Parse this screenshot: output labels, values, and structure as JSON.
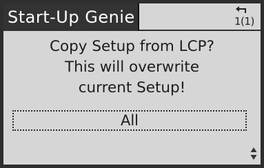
{
  "header": {
    "title": "Start-Up Genie",
    "back_level": "1(1)",
    "back_icon": "back-arrow-icon"
  },
  "message": {
    "lines": [
      "Copy Setup from LCP?",
      "This will overwrite",
      "current Setup!"
    ]
  },
  "selection": {
    "value": "All"
  },
  "scroll_icon": "up-down-arrows-icon",
  "colors": {
    "screen_bg": "#d6d6d6",
    "title_bg": "#333333",
    "title_fg": "#ffffff",
    "text": "#1c1c1c"
  }
}
